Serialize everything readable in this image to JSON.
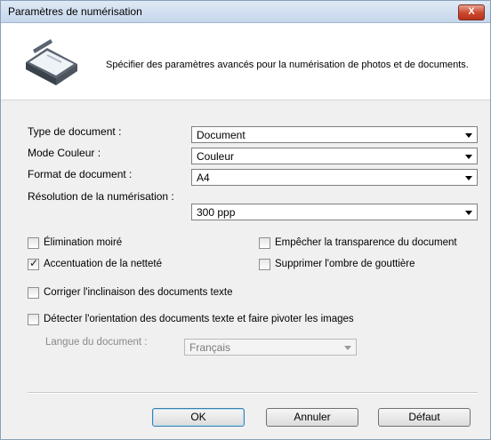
{
  "window": {
    "title": "Paramètres de numérisation",
    "close_label": "X"
  },
  "header": {
    "description": "Spécifier des paramètres avancés pour la numérisation de photos et de documents."
  },
  "fields": [
    {
      "label": "Type de document :",
      "value": "Document"
    },
    {
      "label": "Mode Couleur :",
      "value": "Couleur"
    },
    {
      "label": "Format de document :",
      "value": "A4"
    },
    {
      "label": "Résolution de la numérisation :",
      "value": "300 ppp"
    }
  ],
  "options": {
    "moire": {
      "label": "Élimination moiré",
      "checked": false
    },
    "sharpen": {
      "label": "Accentuation de la netteté",
      "checked": true
    },
    "showthrough": {
      "label": "Empêcher la transparence du document",
      "checked": false
    },
    "gutter": {
      "label": "Supprimer l'ombre de gouttière",
      "checked": false
    },
    "skew": {
      "label": "Corriger l'inclinaison des documents texte",
      "checked": false
    },
    "orientation": {
      "label": "Détecter l'orientation des documents texte et faire pivoter les images",
      "checked": false
    },
    "tick_glyph": "✓"
  },
  "language": {
    "label": "Langue du document :",
    "value": "Français"
  },
  "buttons": {
    "ok": "OK",
    "cancel": "Annuler",
    "default": "Défaut"
  }
}
